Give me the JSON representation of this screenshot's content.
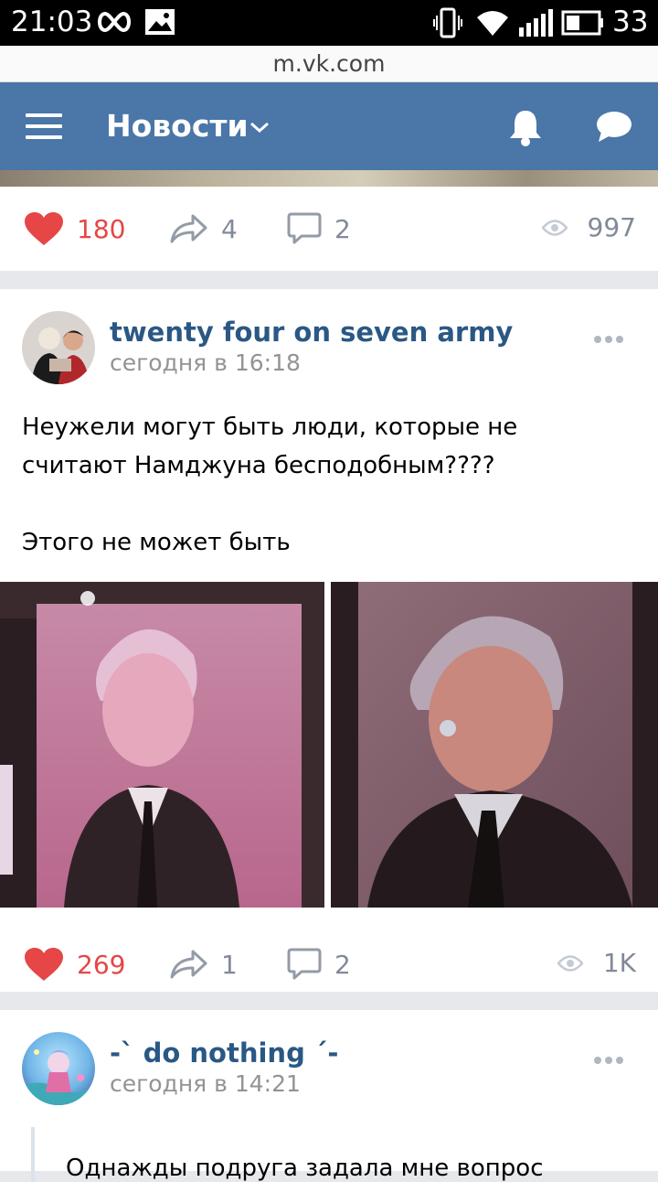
{
  "status_bar": {
    "time": "21:03",
    "battery": "33"
  },
  "browser": {
    "url": "m.vk.com"
  },
  "top_bar": {
    "title": "Новости"
  },
  "prev_post": {
    "likes": "180",
    "shares": "4",
    "comments": "2",
    "views": "997"
  },
  "posts": [
    {
      "author": "twenty four on seven army",
      "date": "сегодня в 16:18",
      "text_lines": [
        "Неужели могут быть люди, которые не",
        "считают Намджуна бесподобным????",
        "Этого не может быть"
      ],
      "likes": "269",
      "shares": "1",
      "comments": "2",
      "views": "1K"
    },
    {
      "author": "-` do nothing ´-",
      "date": "сегодня в 14:21",
      "text_partial": "Однажды подруга задала мне вопрос"
    }
  ],
  "colors": {
    "accent": "#4a76a8",
    "like": "#e64646",
    "link": "#2a5885",
    "muted": "#828a99"
  }
}
